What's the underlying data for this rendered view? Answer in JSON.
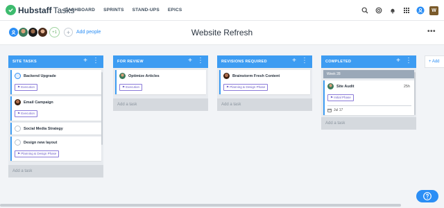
{
  "app": {
    "brand": "Hubstaff",
    "product": "Tasks"
  },
  "nav": [
    "DASHBOARD",
    "SPRINTS",
    "STAND-UPS",
    "EPICS"
  ],
  "user": {
    "initial": "W"
  },
  "board": {
    "title": "Website Refresh",
    "more": "•••",
    "add_people": "Add people",
    "extra_members": "+1"
  },
  "columns": [
    {
      "title": "SITE TASKS",
      "cards": [
        {
          "name": "Backend Upgrade",
          "tag": "Execution",
          "avatar": "team-icon"
        },
        {
          "name": "Email Campaign",
          "tag": "Execution",
          "avatar": "person-avatar"
        },
        {
          "name": "Social Media Strategy",
          "tag": "",
          "avatar": "empty-avatar"
        },
        {
          "name": "Design new layout",
          "tag": "Planning & Design Phase",
          "avatar": "empty-avatar"
        }
      ],
      "add_task": "Add a task"
    },
    {
      "title": "FOR REVIEW",
      "cards": [
        {
          "name": "Optimize Articles",
          "tag": "Execution",
          "avatar": "person-avatar"
        }
      ],
      "add_task": "Add a task"
    },
    {
      "title": "REVISIONS REQUIRED",
      "cards": [
        {
          "name": "Brainstorm Fresh Content",
          "tag": "Planning & Design Phase",
          "avatar": "person-avatar"
        }
      ],
      "add_task": "Add a task"
    },
    {
      "title": "COMPLETED",
      "week": "Week 28",
      "cards": [
        {
          "name": "Site Audit",
          "tag": "Initial Phase",
          "duration": "25h",
          "due": "Jul 17",
          "avatar": "person-avatar"
        }
      ],
      "add_task": "Add a task"
    }
  ],
  "add_list": "+ Add"
}
